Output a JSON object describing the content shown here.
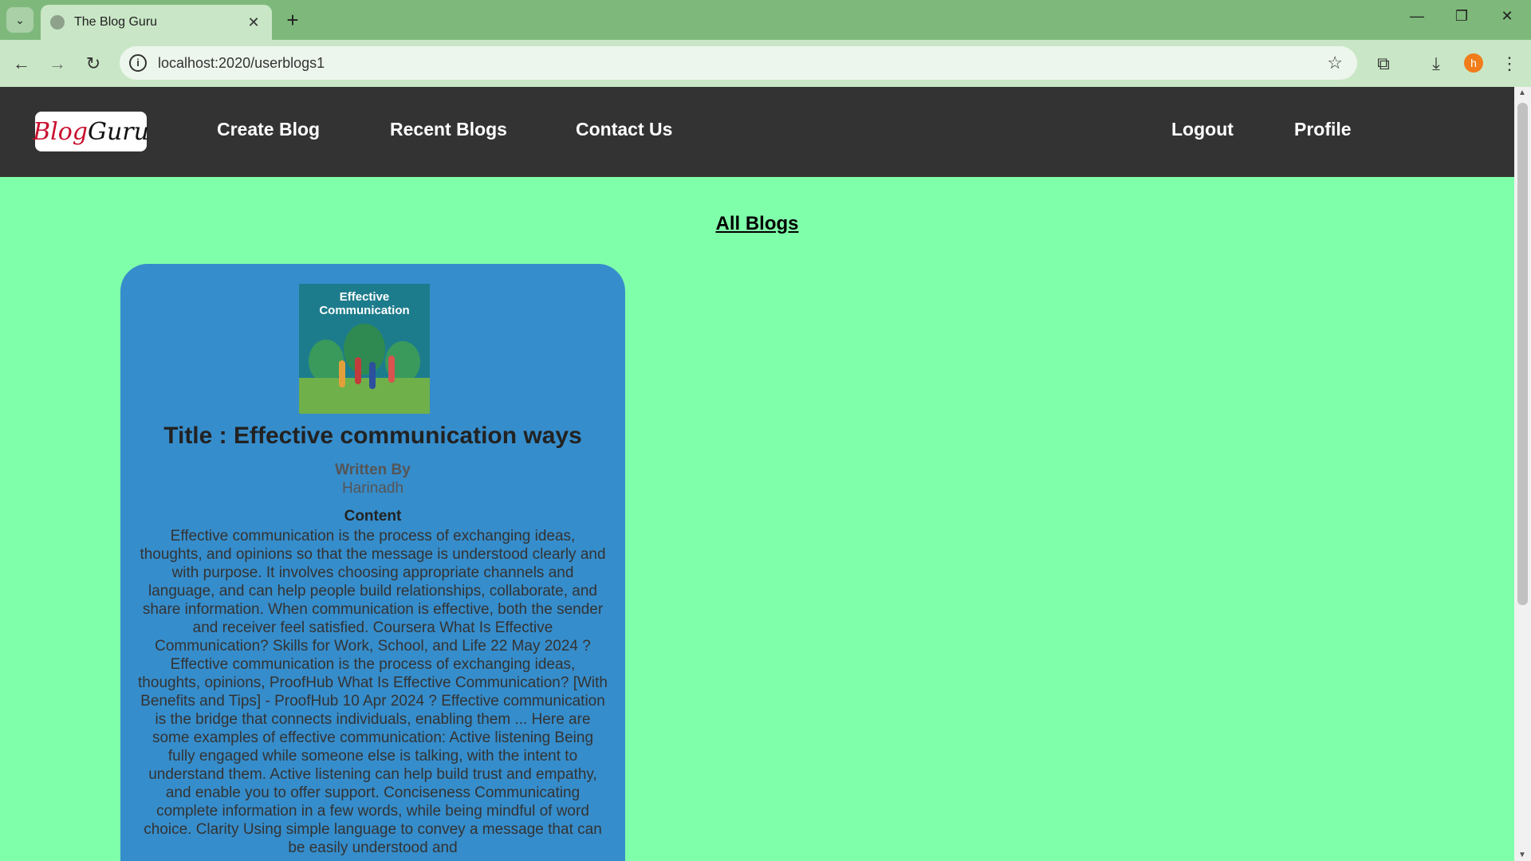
{
  "browser": {
    "tab_title": "The Blog Guru",
    "url": "localhost:2020/userblogs1",
    "profile_initial": "h"
  },
  "navbar": {
    "logo_text_1": "Blog",
    "logo_text_2": "Guru",
    "links": [
      "Create Blog",
      "Recent Blogs",
      "Contact Us"
    ],
    "right_links": [
      "Logout",
      "Profile"
    ]
  },
  "page": {
    "heading": "All Blogs"
  },
  "card": {
    "image_caption": "Effective Communication",
    "title": "Title : Effective communication ways",
    "written_by_label": "Written By",
    "author": "Harinadh",
    "content_label": "Content",
    "content": "Effective communication is the process of exchanging ideas, thoughts, and opinions so that the message is understood clearly and with purpose. It involves choosing appropriate channels and language, and can help people build relationships, collaborate, and share information. When communication is effective, both the sender and receiver feel satisfied. Coursera What Is Effective Communication? Skills for Work, School, and Life 22 May 2024 ? Effective communication is the process of exchanging ideas, thoughts, opinions, ProofHub What Is Effective Communication? [With Benefits and Tips] - ProofHub 10 Apr 2024 ? Effective communication is the bridge that connects individuals, enabling them ... Here are some examples of effective communication: Active listening Being fully engaged while someone else is talking, with the intent to understand them. Active listening can help build trust and empathy, and enable you to offer support. Conciseness Communicating complete information in a few words, while being mindful of word choice. Clarity Using simple language to convey a message that can be easily understood and"
  }
}
